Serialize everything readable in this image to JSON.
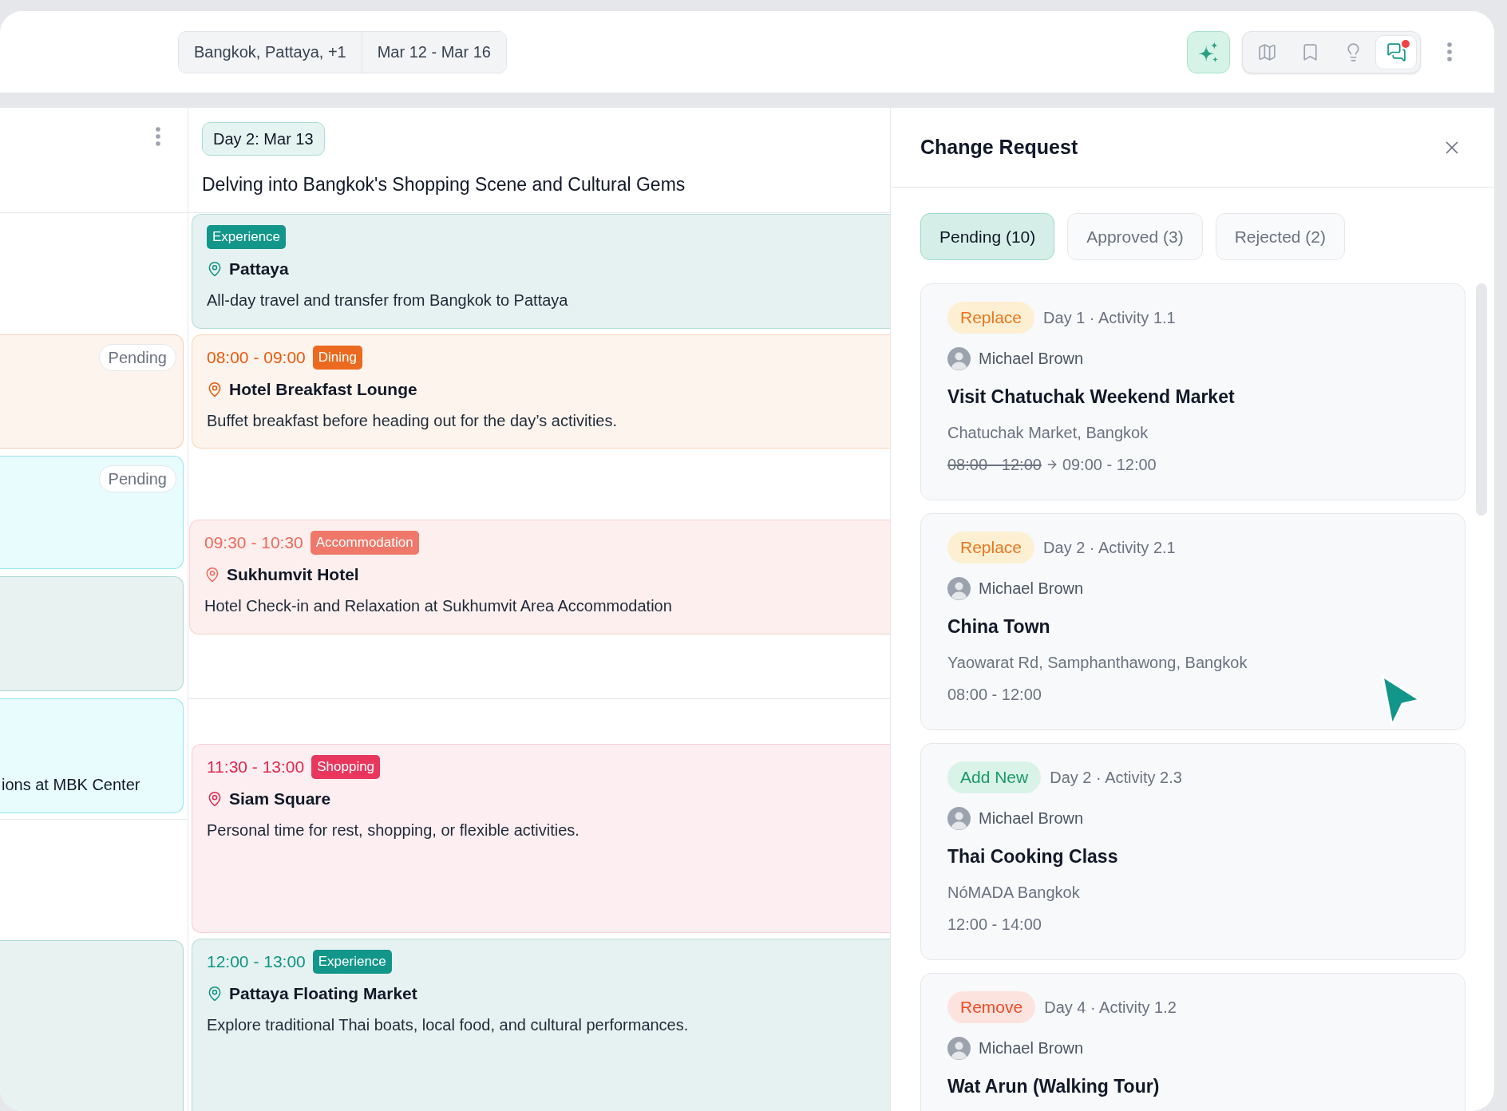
{
  "top_bar": {
    "destinations": "Bangkok, Pattaya, +1",
    "dates": "Mar 12 - Mar 16",
    "tools": [
      {
        "selected": false,
        "unread": false
      },
      {
        "selected": false,
        "unread": false
      },
      {
        "selected": false,
        "unread": false
      },
      {
        "selected": true,
        "unread": true
      }
    ]
  },
  "previous_day": {
    "cards": [
      {
        "color": "#fdf4ee",
        "status": "Pending"
      },
      {
        "color": "#e8fbfd",
        "status": "Pending"
      },
      {
        "color": "#e7f2f1"
      },
      {
        "color": "#e8fbfd",
        "text": "ions at MBK Center"
      },
      {
        "color": "#e7f2f1"
      }
    ]
  },
  "day": {
    "label": "Day 2: Mar 13",
    "title": "Delving into Bangkok's Shopping Scene and Cultural Gems",
    "activities": [
      {
        "kind": "experience",
        "category": "Experience",
        "place": "Pattaya",
        "description": "All-day travel and transfer from Bangkok to Pattaya"
      },
      {
        "kind": "dining",
        "time": "08:00 - 09:00",
        "category": "Dining",
        "place": "Hotel Breakfast Lounge",
        "description": "Buffet breakfast before heading out for the day’s activities."
      },
      {
        "kind": "accommodation",
        "time": "09:30 - 10:30",
        "category": "Accommodation",
        "place": "Sukhumvit Hotel",
        "description": "Hotel Check-in and Relaxation at Sukhumvit Area Accommodation"
      },
      {
        "kind": "shopping",
        "time": "11:30 - 13:00",
        "category": "Shopping",
        "place": "Siam Square",
        "description": "Personal time for rest, shopping, or flexible activities."
      },
      {
        "kind": "experience",
        "time": "12:00 - 13:00",
        "category": "Experience",
        "place": "Pattaya Floating Market",
        "description": "Explore traditional Thai boats, local food, and cultural performances."
      }
    ]
  },
  "change_request": {
    "title": "Change Request",
    "tabs": [
      {
        "label": "Pending (10)",
        "selected": true
      },
      {
        "label": "Approved (3)",
        "selected": false
      },
      {
        "label": "Rejected (2)",
        "selected": false
      }
    ],
    "requests": [
      {
        "kind": "replace",
        "action": "Replace",
        "ref": "Day 1 · Activity 1.1",
        "author": "Michael Brown",
        "title": "Visit Chatuchak Weekend Market",
        "location": "Chatuchak Market, Bangkok",
        "time_old": "08:00 - 12:00",
        "time": "09:00 - 12:00"
      },
      {
        "kind": "replace",
        "action": "Replace",
        "ref": "Day 2 · Activity 2.1",
        "author": "Michael Brown",
        "title": "China Town",
        "location": "Yaowarat Rd, Samphanthawong, Bangkok",
        "time": "08:00 - 12:00"
      },
      {
        "kind": "add",
        "action": "Add New",
        "ref": "Day 2 · Activity 2.3",
        "author": "Michael Brown",
        "title": "Thai Cooking Class",
        "location": "NóMADA Bangkok",
        "time": "12:00 - 14:00"
      },
      {
        "kind": "remove",
        "action": "Remove",
        "ref": "Day 4 · Activity 1.2",
        "author": "Michael Brown",
        "title": "Wat Arun (Walking Tour)"
      }
    ]
  }
}
